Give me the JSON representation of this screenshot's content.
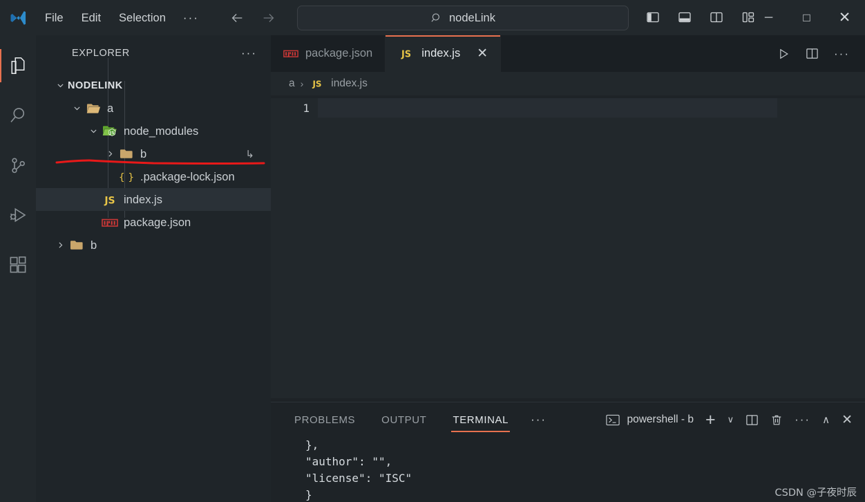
{
  "titlebar": {
    "logo_icon": "vscode-logo-icon",
    "menus": [
      {
        "label": "File"
      },
      {
        "label": "Edit"
      },
      {
        "label": "Selection"
      }
    ],
    "menu_overflow": "···",
    "nav_back_icon": "arrow-left-icon",
    "nav_forward_icon": "arrow-right-icon",
    "command_center": {
      "search_icon": "search-icon",
      "value": "nodeLink"
    },
    "layout_buttons": [
      {
        "name": "toggle-primary-sidebar",
        "icon": "layout-sidebar-left-icon"
      },
      {
        "name": "toggle-panel",
        "icon": "layout-panel-icon"
      },
      {
        "name": "toggle-secondary-sidebar",
        "icon": "layout-sidebar-right-icon"
      },
      {
        "name": "customize-layout",
        "icon": "layout-customize-icon"
      }
    ],
    "window_controls": {
      "minimize": "─",
      "maximize": "□",
      "close": "✕"
    }
  },
  "activitybar": {
    "items": [
      {
        "name": "explorer",
        "icon": "files-icon",
        "active": true
      },
      {
        "name": "search",
        "icon": "search-icon",
        "active": false
      },
      {
        "name": "source-control",
        "icon": "source-control-icon",
        "active": false
      },
      {
        "name": "run-and-debug",
        "icon": "run-debug-icon",
        "active": false
      },
      {
        "name": "extensions",
        "icon": "extensions-icon",
        "active": false
      }
    ],
    "active_indicator_color": "#e8714f"
  },
  "sidebar": {
    "title": "EXPLORER",
    "more_actions": "···",
    "tree": [
      {
        "label": "NODELINK",
        "kind": "root",
        "expanded": true
      },
      {
        "label": "a",
        "kind": "folder",
        "expanded": true
      },
      {
        "label": "node_modules",
        "kind": "node-folder",
        "expanded": true
      },
      {
        "label": "b",
        "kind": "folder",
        "expanded": false,
        "symlink": "↳",
        "annotated": true
      },
      {
        "label": ".package-lock.json",
        "kind": "json",
        "expanded": null
      },
      {
        "label": "index.js",
        "kind": "js",
        "selected": true
      },
      {
        "label": "package.json",
        "kind": "npm"
      },
      {
        "label": "b",
        "kind": "folder",
        "expanded": false
      }
    ],
    "annotation_color": "#e81919"
  },
  "editor": {
    "tabs": [
      {
        "label": "package.json",
        "icon": "npm-icon",
        "active": false
      },
      {
        "label": "index.js",
        "icon": "js-icon",
        "active": true,
        "close": "✕"
      }
    ],
    "actions": [
      {
        "name": "run-file-button",
        "icon": "play-icon"
      },
      {
        "name": "split-editor-button",
        "icon": "split-editor-icon"
      },
      {
        "name": "editor-more-actions",
        "icon": "more-icon",
        "glyph": "···"
      }
    ],
    "breadcrumb": {
      "folder": "a",
      "separator": "›",
      "file_icon": "js-icon",
      "file": "index.js"
    },
    "line_numbers": [
      "1"
    ],
    "content": ""
  },
  "panel": {
    "tabs": [
      {
        "label": "PROBLEMS",
        "active": false
      },
      {
        "label": "OUTPUT",
        "active": false
      },
      {
        "label": "TERMINAL",
        "active": true
      }
    ],
    "more_tabs": "···",
    "terminal_name": "powershell - b",
    "terminal_icon": "terminal-icon",
    "actions": [
      {
        "name": "new-terminal-button",
        "glyph": "+"
      },
      {
        "name": "terminal-profile-dropdown",
        "glyph": "∨"
      },
      {
        "name": "split-terminal-button",
        "icon": "split-icon"
      },
      {
        "name": "kill-terminal-button",
        "icon": "trash-icon"
      },
      {
        "name": "panel-more-actions",
        "glyph": "···"
      },
      {
        "name": "maximize-panel-button",
        "glyph": "∧"
      },
      {
        "name": "close-panel-button",
        "glyph": "✕"
      }
    ],
    "terminal_lines": [
      "  },",
      "  \"author\": \"\",",
      "  \"license\": \"ISC\"",
      "  }"
    ]
  },
  "watermark": "CSDN @子夜时辰",
  "colors": {
    "accent": "#e8714f",
    "titlebar_bg": "#22282c",
    "sidebar_bg": "#1f2529",
    "editor_bg": "#22282c",
    "tabbar_bg": "#1a1f23",
    "js_yellow": "#e8c547",
    "npm_red": "#cb3837",
    "folder_tan": "#c9a66b",
    "node_green": "#7bc043"
  }
}
